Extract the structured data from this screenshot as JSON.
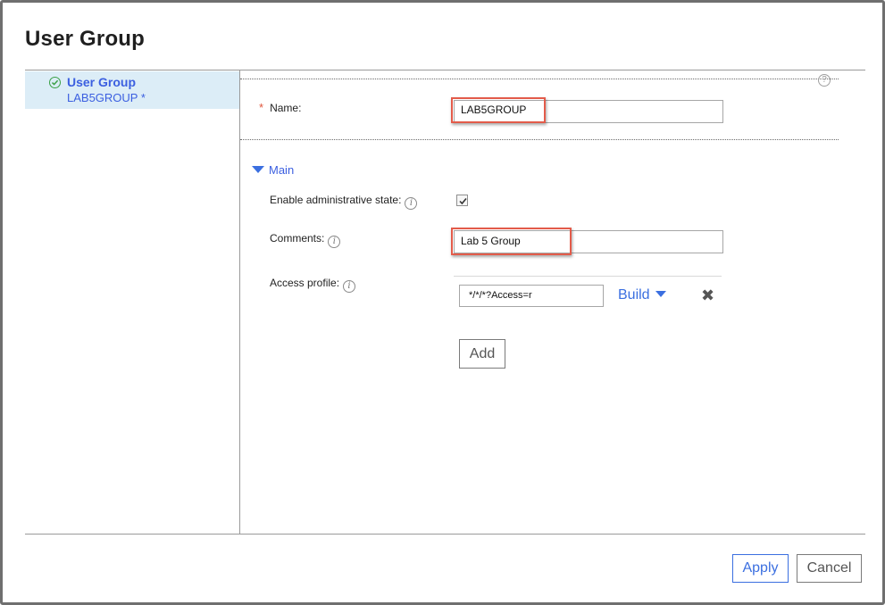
{
  "dialog": {
    "title": "User Group"
  },
  "sidebar": {
    "items": [
      {
        "title": "User Group",
        "subtitle": "LAB5GROUP *"
      }
    ]
  },
  "form": {
    "help_icon": "?",
    "name": {
      "required_marker": "*",
      "label": "Name:",
      "value": "LAB5GROUP"
    },
    "main_section": {
      "label": "Main"
    },
    "enable_admin_state": {
      "label": "Enable administrative state:",
      "checked": true
    },
    "comments": {
      "label": "Comments:",
      "value": "Lab 5 Group"
    },
    "access_profile": {
      "label": "Access profile:",
      "entries": [
        "*/*/*?Access=r"
      ],
      "build_label": "Build",
      "add_label": "Add"
    }
  },
  "footer": {
    "apply_label": "Apply",
    "cancel_label": "Cancel"
  },
  "icons": {
    "sidebar_status": "check-circle-icon",
    "info": "info-icon",
    "help": "help-icon",
    "remove": "x-remove-icon",
    "dropdown": "triangle-down-icon"
  },
  "colors": {
    "link_blue": "#3b5fe0",
    "highlight_red": "#e35b4a",
    "selected_bg": "#dcedf7",
    "success_green": "#3aa046"
  }
}
